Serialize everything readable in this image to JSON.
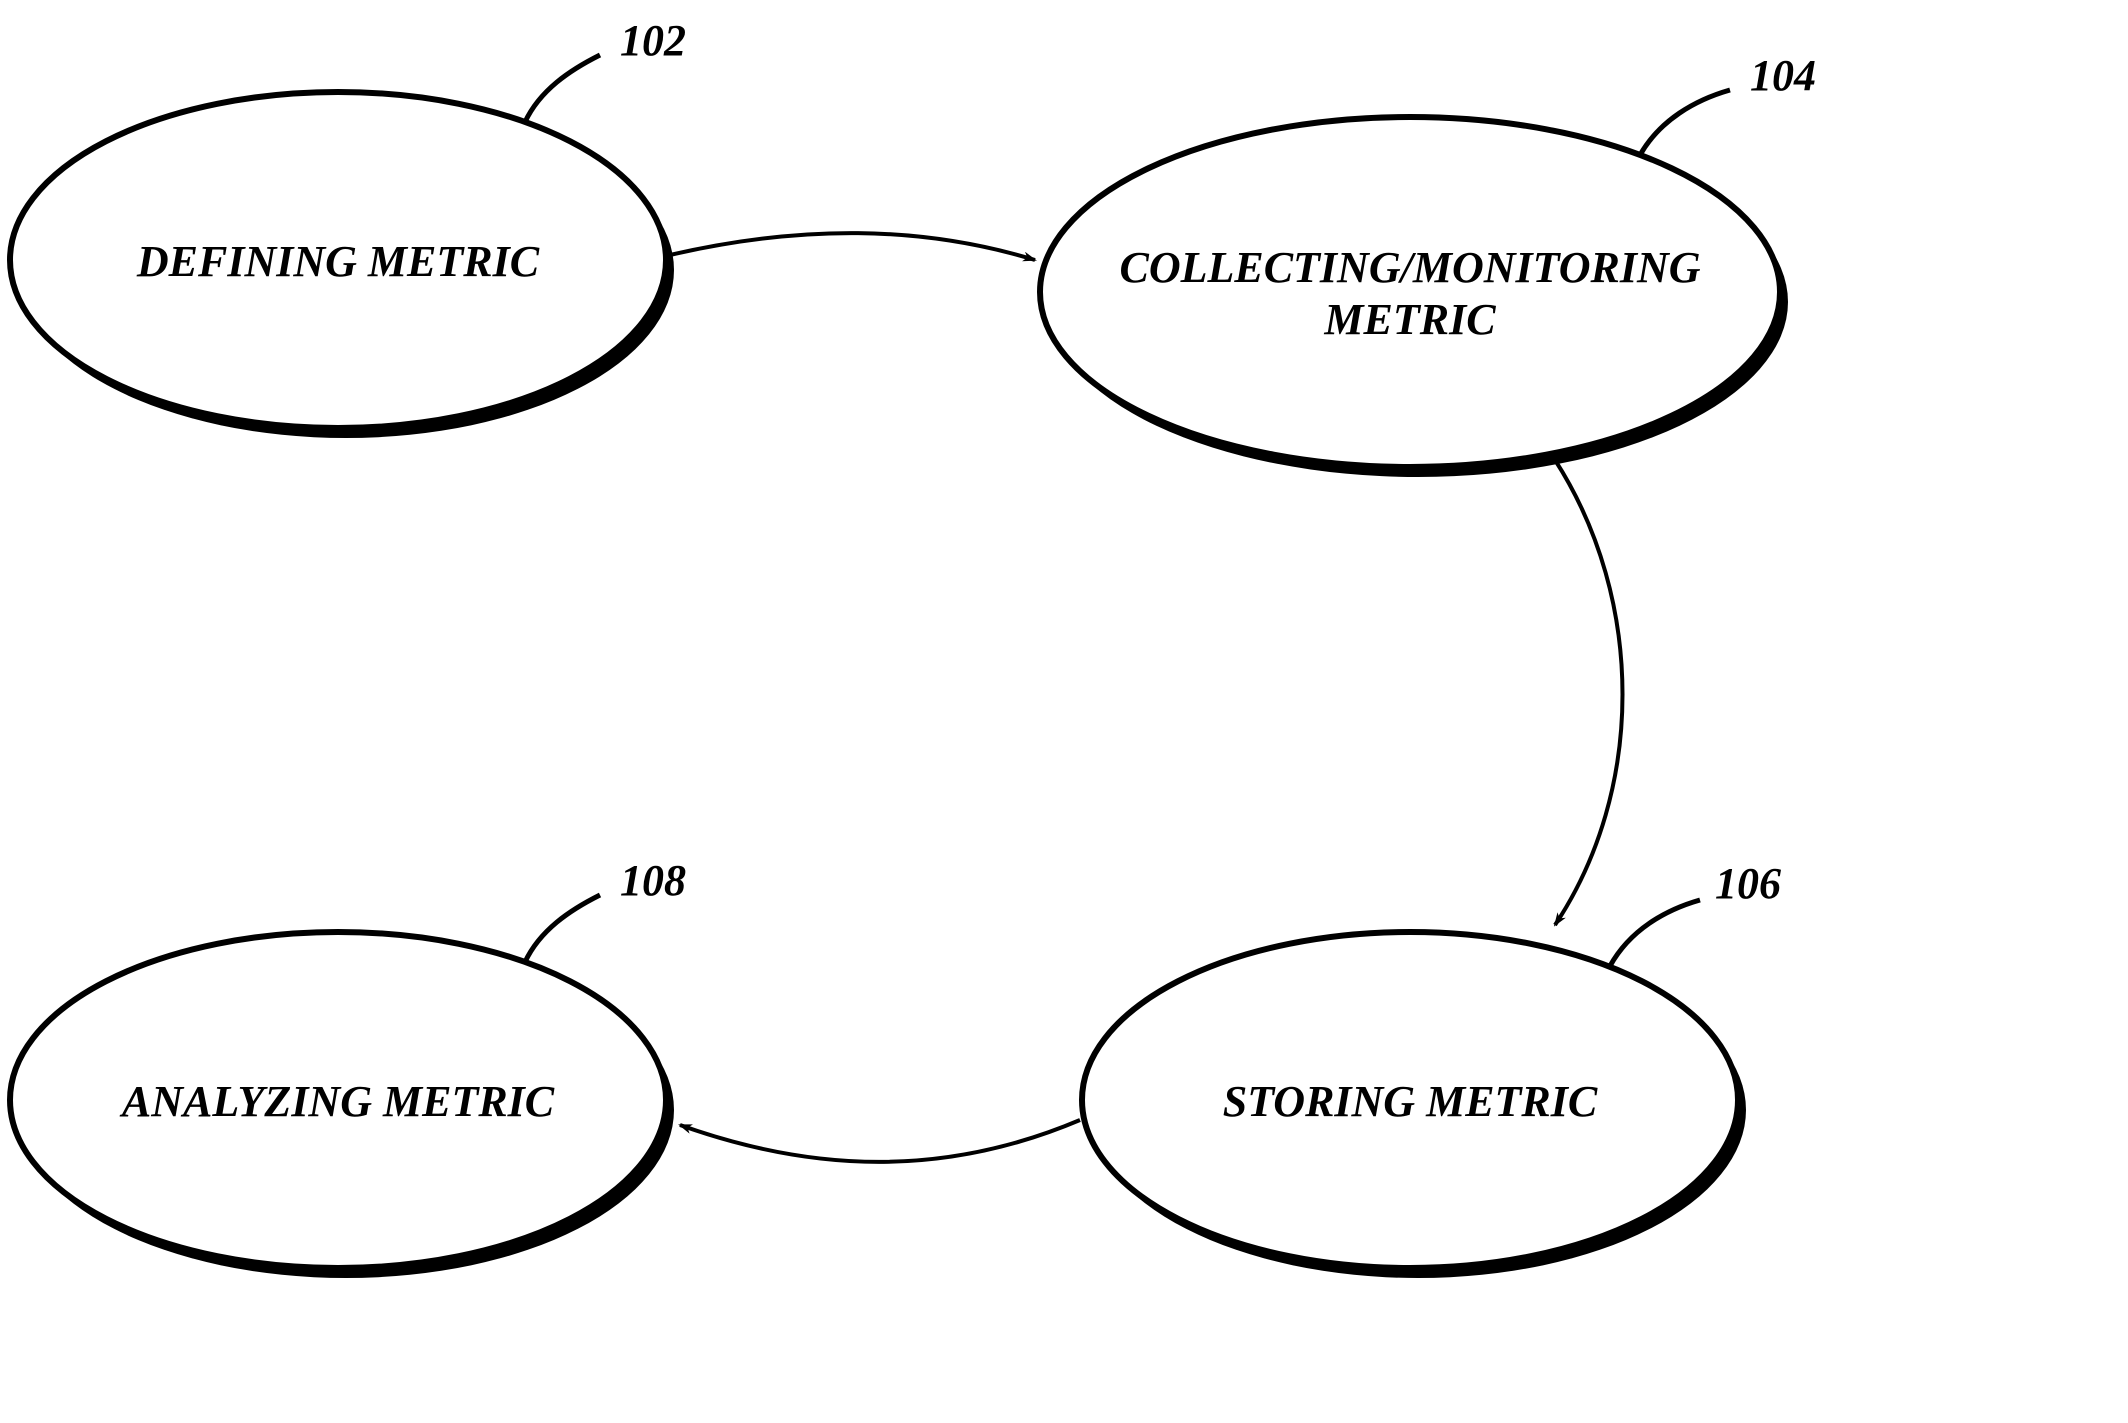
{
  "nodes": {
    "defining": {
      "label": "DEFINING METRIC",
      "ref": "102"
    },
    "collecting": {
      "line1": "COLLECTING/MONITORING",
      "line2": "METRIC",
      "ref": "104"
    },
    "storing": {
      "label": "STORING METRIC",
      "ref": "106"
    },
    "analyzing": {
      "label": "ANALYZING METRIC",
      "ref": "108"
    }
  },
  "chart_data": {
    "type": "flow-diagram",
    "nodes": [
      {
        "id": "102",
        "label": "DEFINING METRIC"
      },
      {
        "id": "104",
        "label": "COLLECTING/MONITORING METRIC"
      },
      {
        "id": "106",
        "label": "STORING METRIC"
      },
      {
        "id": "108",
        "label": "ANALYZING METRIC"
      }
    ],
    "edges": [
      {
        "from": "102",
        "to": "104"
      },
      {
        "from": "104",
        "to": "106"
      },
      {
        "from": "106",
        "to": "108"
      }
    ]
  }
}
